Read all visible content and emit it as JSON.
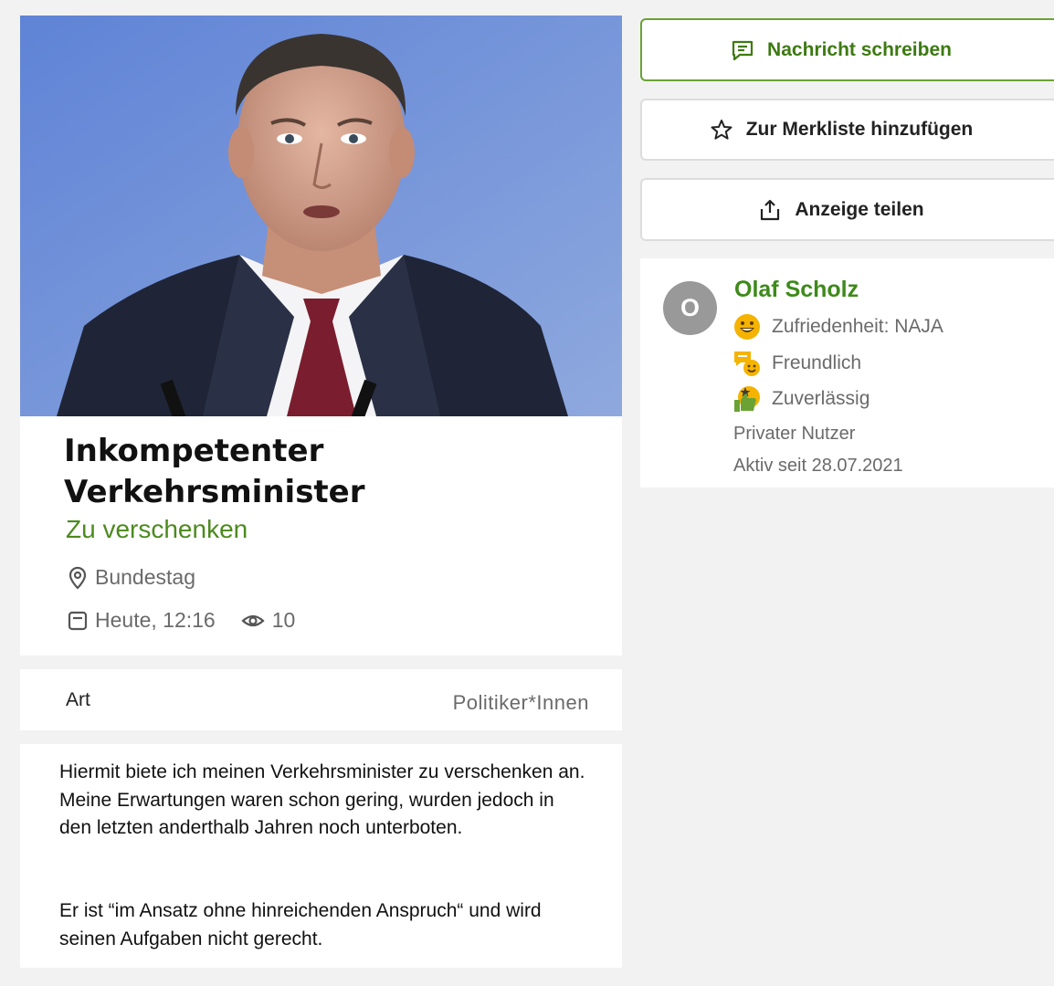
{
  "listing": {
    "title": "Inkompetenter Verkehrsminister",
    "price": "Zu verschenken",
    "location": "Bundestag",
    "date": "Heute, 12:16",
    "views": "10",
    "photo_alt": "Listing photo"
  },
  "details": {
    "label": "Art",
    "value": "Politiker*Innen"
  },
  "description": {
    "paragraph1": "Hiermit biete ich meinen Verkehrsminister zu verschenken an. Meine Erwartungen waren schon gering,  wurden jedoch in den letzten anderthalb Jahren noch unterboten.",
    "paragraph2": "Er  ist “im Ansatz ohne hinreichenden Anspruch“  und wird seinen Aufgaben nicht gerecht."
  },
  "actions": {
    "message_label": "Nachricht schreiben",
    "watchlist_label": "Zur Merkliste hinzufügen",
    "share_label": "Anzeige teilen"
  },
  "seller": {
    "avatar_initial": "O",
    "name": "Olaf Scholz",
    "satisfaction": "Zufriedenheit: NAJA",
    "badge_friendly": "Freundlich",
    "badge_reliable": "Zuverlässig",
    "type": "Privater Nutzer",
    "active_since": "Aktiv seit 28.07.2021"
  },
  "colors": {
    "accent_green": "#4c8a1e",
    "page_bg": "#f2f2f2"
  },
  "icons": {
    "message": "chat-bubble-icon",
    "watchlist": "star-icon",
    "share": "share-icon",
    "location": "map-pin-icon",
    "date": "calendar-icon",
    "views": "eye-icon"
  }
}
